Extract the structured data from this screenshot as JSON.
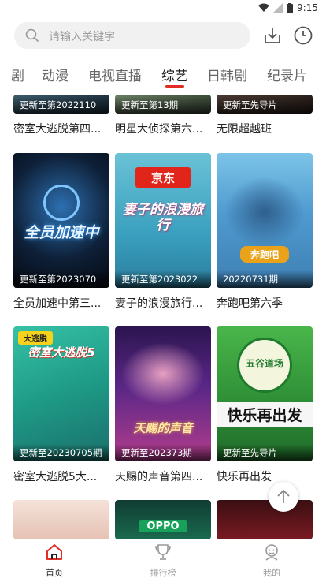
{
  "status_bar": {
    "time": "9:15"
  },
  "search": {
    "placeholder": "请输入关键字"
  },
  "tabs": [
    "剧",
    "动漫",
    "电视直播",
    "综艺",
    "日韩剧",
    "纪录片"
  ],
  "active_tab": "综艺",
  "colors": {
    "accent": "#e02e24"
  },
  "cards": [
    {
      "title": "密室大逃脱第四...",
      "update": "更新至第2022110"
    },
    {
      "title": "明星大侦探第六...",
      "update": "更新至第13期"
    },
    {
      "title": "无限超越班",
      "update": "更新至先导片"
    },
    {
      "title": "全员加速中第三...",
      "update": "更新至第2023070"
    },
    {
      "title": "妻子的浪漫旅行...",
      "update": "更新至第2023022"
    },
    {
      "title": "奔跑吧第六季",
      "update": "20220731期"
    },
    {
      "title": "密室大逃脱5大...",
      "update": "更新至20230705期"
    },
    {
      "title": "天赐的声音第四...",
      "update": "更新至202373期"
    },
    {
      "title": "快乐再出发",
      "update": "更新至先导片"
    }
  ],
  "poster_text": {
    "p4": "全员加速中",
    "p5_brand": "京东",
    "p5_title": "妻子的浪漫旅行",
    "p6_badge": "奔跑吧",
    "p7_badge": "大逃脱",
    "p7_title": "密室大逃脱5",
    "p8_title": "天赐的声音",
    "p9_badge": "五谷道场",
    "p9_title": "快乐再出发",
    "p11_brand": "OPPO"
  },
  "bottom_nav": [
    {
      "label": "首页",
      "icon": "home-icon"
    },
    {
      "label": "排行榜",
      "icon": "trophy-icon"
    },
    {
      "label": "我的",
      "icon": "user-icon"
    }
  ]
}
